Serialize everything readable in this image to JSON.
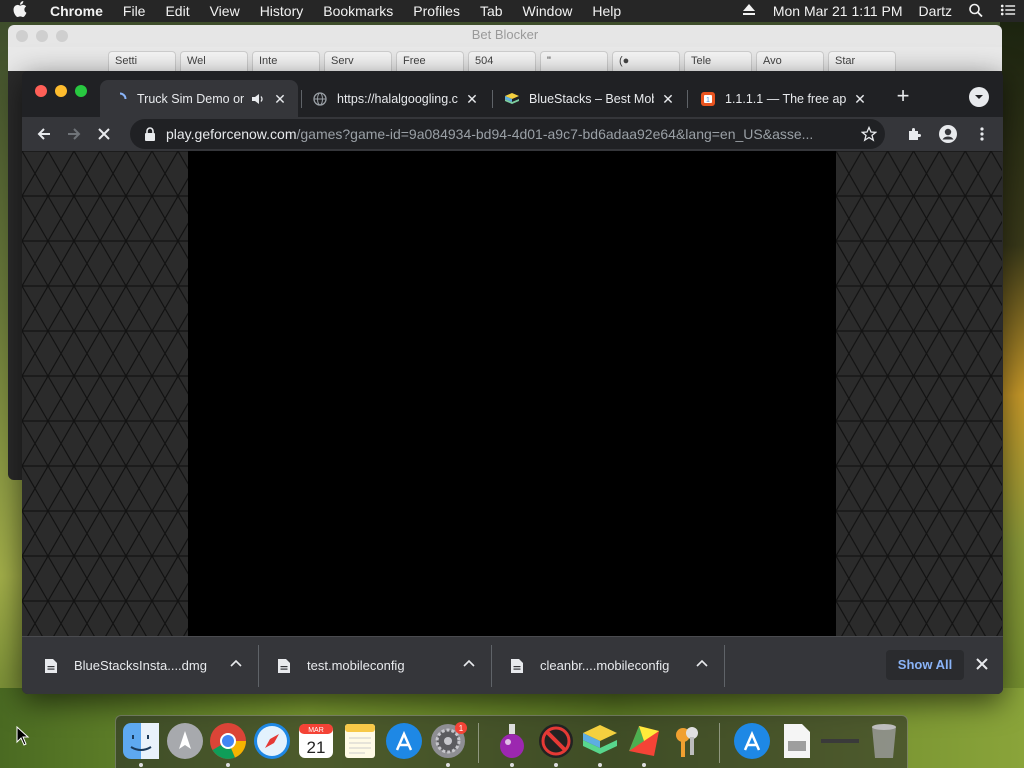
{
  "menubar": {
    "app_name": "Chrome",
    "items": [
      "File",
      "Edit",
      "View",
      "History",
      "Bookmarks",
      "Profiles",
      "Tab",
      "Window",
      "Help"
    ],
    "clock": "Mon Mar 21  1:11 PM",
    "user": "Dartz"
  },
  "background_window": {
    "title": "Bet Blocker",
    "tabs": [
      "Setti",
      "Wel",
      "Inte",
      "Serv",
      "Free",
      "504",
      "\"",
      "(●",
      "Tele",
      "Avo",
      "Star"
    ]
  },
  "browser": {
    "tabs": [
      {
        "title": "Truck Sim Demo on",
        "active": true,
        "audio": true,
        "favicon": "loading-spinner-icon"
      },
      {
        "title": "https://halalgoogling.com",
        "active": false,
        "favicon": "globe-icon"
      },
      {
        "title": "BlueStacks – Best Mob",
        "active": false,
        "favicon": "bluestacks-icon"
      },
      {
        "title": "1.1.1.1 — The free app",
        "active": false,
        "favicon": "cloudflare-icon"
      }
    ],
    "url_domain": "play.geforcenow.com",
    "url_path": "/games?game-id=9a084934-bd94-4d01-a9c7-bd6adaa92e64&lang=en_US&asse...",
    "downloads": [
      {
        "name": "BlueStacksInsta....dmg"
      },
      {
        "name": "test.mobileconfig"
      },
      {
        "name": "cleanbr....mobileconfig"
      }
    ],
    "show_all_label": "Show All"
  },
  "dock": {
    "apps": [
      "finder-icon",
      "launchpad-icon",
      "chrome-icon",
      "safari-icon",
      "calendar-icon",
      "notes-icon",
      "app-store-icon",
      "system-preferences-icon",
      "potion-app-icon",
      "stop-app-icon",
      "bluestacks-icon",
      "bluestacks-x-icon",
      "keychain-icon",
      "app-store-downloads-icon",
      "document-icon",
      "minimized-window-icon",
      "trash-icon"
    ],
    "calendar_month": "MAR",
    "calendar_day": "21",
    "sysprefs_badge": "1"
  },
  "colors": {
    "accent_blue": "#8ab4f8",
    "chrome_dark": "#202124",
    "toolbar": "#35363a"
  }
}
